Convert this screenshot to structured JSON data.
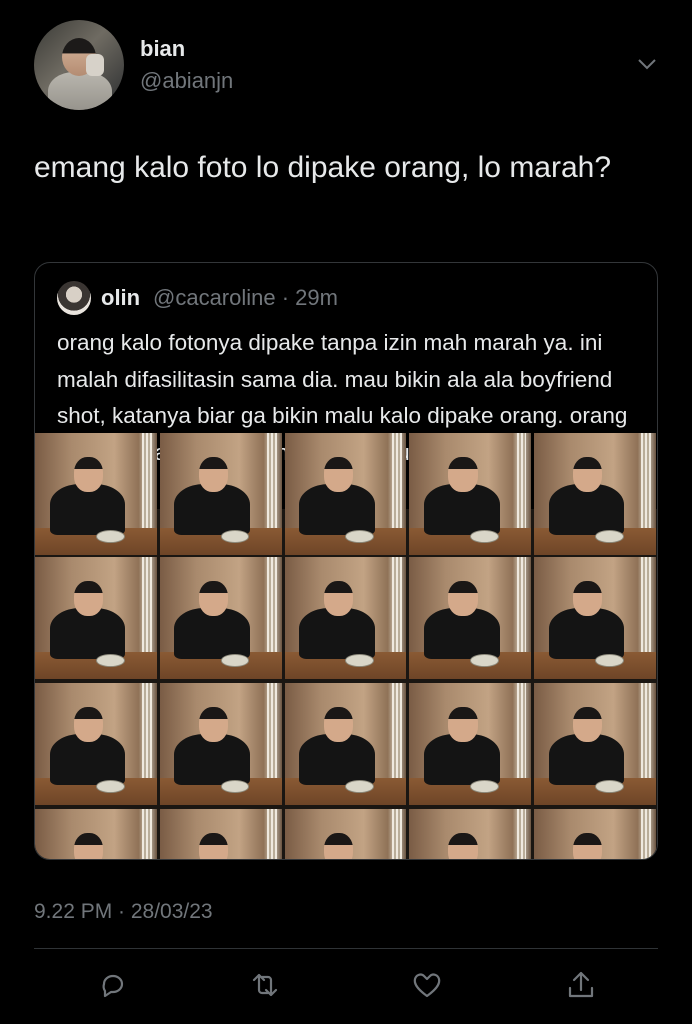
{
  "author": {
    "name": "bian",
    "handle": "@abianjn"
  },
  "tweet": {
    "text": "emang kalo foto lo dipake orang, lo marah?",
    "timestamp": "9.22 PM · 28/03/23"
  },
  "quoted": {
    "name": "olin",
    "handle_time": "@cacaroline · 29m",
    "text": "orang kalo fotonya dipake tanpa izin mah marah ya. ini malah difasilitasin sama dia. mau bikin ala ala boyfriend shot, katanya biar ga bikin malu kalo dipake orang. orang cakep emang kelakuannya agak kurang masuk akal gini ya?",
    "media": {
      "type": "photo-collage",
      "columns": 5,
      "rows": 4
    }
  },
  "actions": [
    {
      "name": "reply-icon"
    },
    {
      "name": "retweet-icon"
    },
    {
      "name": "like-icon"
    },
    {
      "name": "share-icon"
    }
  ],
  "colors": {
    "background": "#000000",
    "text": "#e7e9ea",
    "secondary": "#71767b",
    "border": "#333639"
  }
}
